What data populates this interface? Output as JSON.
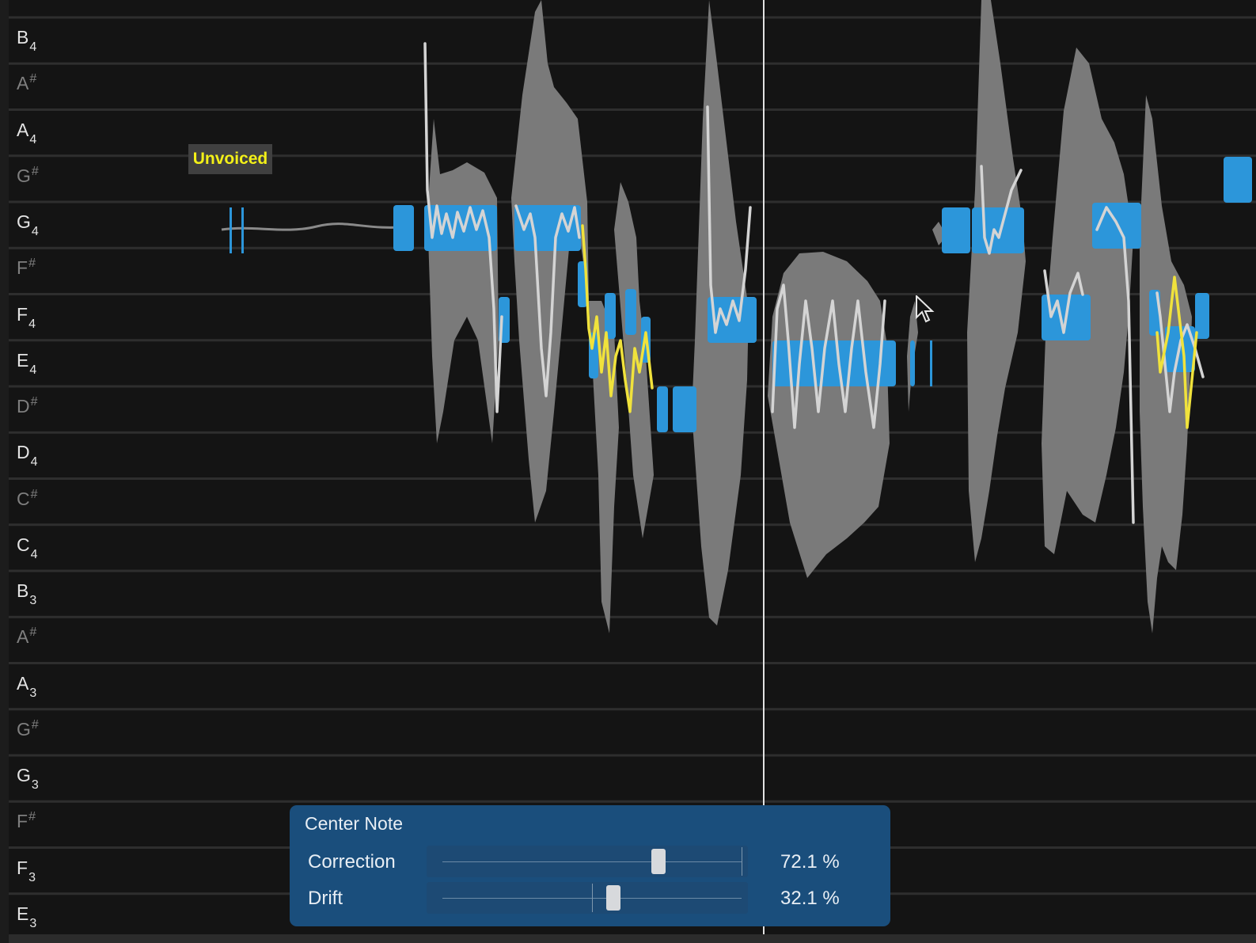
{
  "piano_keys": [
    {
      "note": "B",
      "octave": "4",
      "sharp": false
    },
    {
      "note": "A",
      "octave": "",
      "sharp": true
    },
    {
      "note": "A",
      "octave": "4",
      "sharp": false
    },
    {
      "note": "G",
      "octave": "",
      "sharp": true
    },
    {
      "note": "G",
      "octave": "4",
      "sharp": false
    },
    {
      "note": "F",
      "octave": "",
      "sharp": true
    },
    {
      "note": "F",
      "octave": "4",
      "sharp": false
    },
    {
      "note": "E",
      "octave": "4",
      "sharp": false
    },
    {
      "note": "D",
      "octave": "",
      "sharp": true
    },
    {
      "note": "D",
      "octave": "4",
      "sharp": false
    },
    {
      "note": "C",
      "octave": "",
      "sharp": true
    },
    {
      "note": "C",
      "octave": "4",
      "sharp": false
    },
    {
      "note": "B",
      "octave": "3",
      "sharp": false
    },
    {
      "note": "A",
      "octave": "",
      "sharp": true
    },
    {
      "note": "A",
      "octave": "3",
      "sharp": false
    },
    {
      "note": "G",
      "octave": "",
      "sharp": true
    },
    {
      "note": "G",
      "octave": "3",
      "sharp": false
    },
    {
      "note": "F",
      "octave": "",
      "sharp": true
    },
    {
      "note": "F",
      "octave": "3",
      "sharp": false
    },
    {
      "note": "E",
      "octave": "3",
      "sharp": false
    }
  ],
  "sharp_symbol": "#",
  "unvoiced_label": "Unvoiced",
  "center_note": {
    "title": "Center Note",
    "correction": {
      "label": "Correction",
      "value": 72.1,
      "display": "72.1 %"
    },
    "drift": {
      "label": "Drift",
      "value": 32.1,
      "display": "32.1 %"
    }
  },
  "colors": {
    "background": "#141414",
    "note_blob": "#2c96da",
    "waveform": "#7a7a7a",
    "pitch_curve": "#d4d4d4",
    "corrected_curve": "#f0e23c",
    "unvoiced_text": "#f3f018",
    "panel": "#1a4e7c"
  }
}
